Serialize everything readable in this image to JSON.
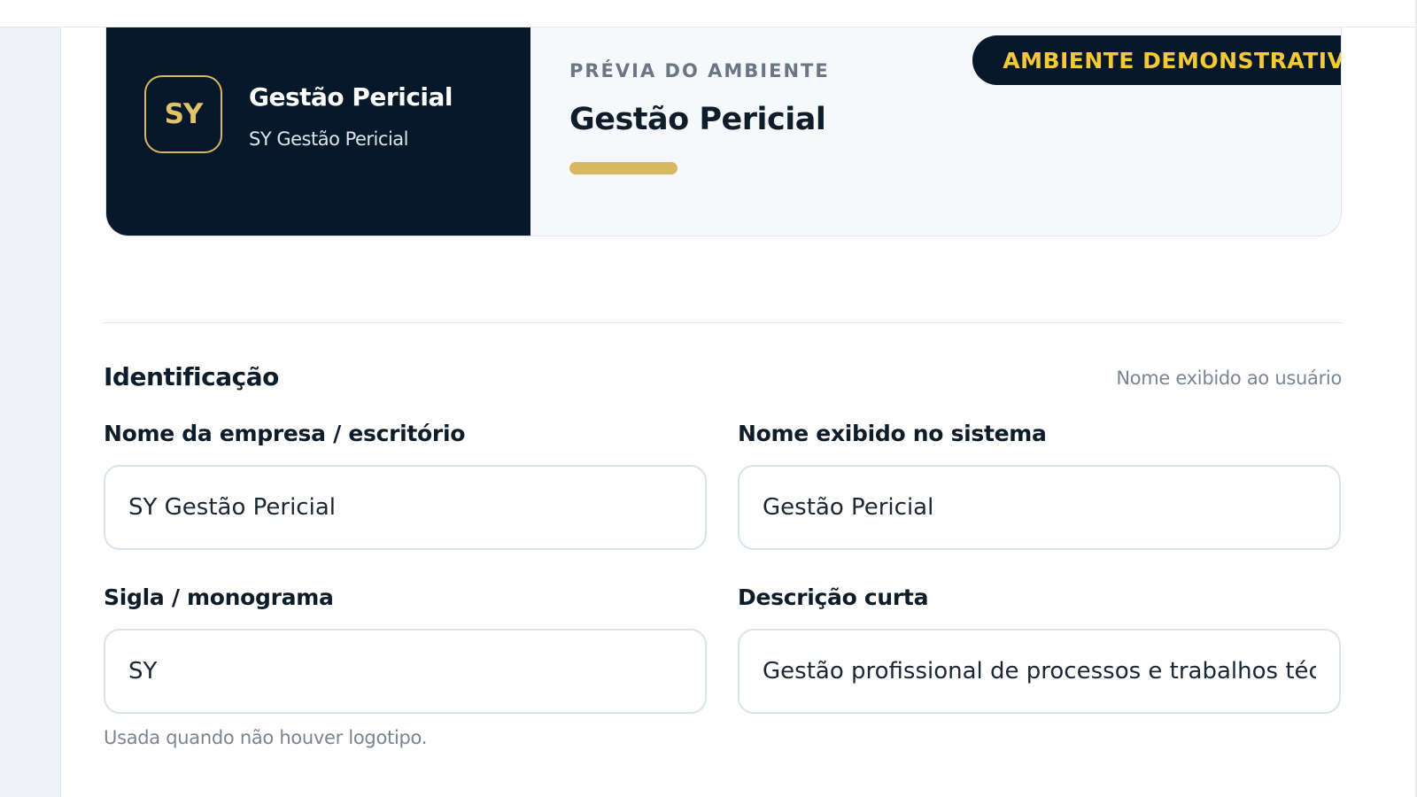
{
  "preview": {
    "monogram": "SY",
    "brand_name": "Gestão Pericial",
    "brand_subtitle": "SY Gestão Pericial",
    "label": "PRÉVIA DO AMBIENTE",
    "title": "Gestão Pericial",
    "badge": "AMBIENTE DEMONSTRATIVO"
  },
  "identification": {
    "title": "Identificação",
    "note": "Nome exibido ao usuário",
    "fields": {
      "company_name": {
        "label": "Nome da empresa / escritório",
        "value": "SY Gestão Pericial"
      },
      "display_name": {
        "label": "Nome exibido no sistema",
        "value": "Gestão Pericial"
      },
      "monogram": {
        "label": "Sigla / monograma",
        "value": "SY",
        "helper": "Usada quando não houver logotipo."
      },
      "short_description": {
        "label": "Descrição curta",
        "value": "Gestão profissional de processos e trabalhos técnicos"
      }
    }
  },
  "colors": {
    "dark_navy": "#06182a",
    "gold_accent": "#d8b860",
    "badge_text": "#f4c937"
  }
}
